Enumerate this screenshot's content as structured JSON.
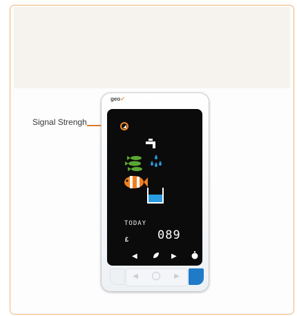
{
  "annotation": {
    "label": "Signal Strengh"
  },
  "device": {
    "brand": "geo",
    "brand_mark": "✓",
    "screen": {
      "day_label": "TODAY",
      "currency_symbol": "£",
      "reading": "089",
      "icons": [
        "signal-strength-icon",
        "water-tap-icon",
        "water-drops-icon",
        "fish-icon",
        "clownfish-icon",
        "water-tank-icon"
      ],
      "controls": [
        "left-arrow-icon",
        "leaf-icon",
        "right-arrow-icon",
        "timer-icon"
      ]
    },
    "buttons": [
      "left-button",
      "center-button",
      "right-button"
    ]
  },
  "colors": {
    "frame_border": "#f2b27a",
    "banner": "#f6f3ef",
    "leader": "#e07b25",
    "screen": "#0b0b0b",
    "fish": "#5aa832",
    "clownfish": "#f07f1f",
    "water": "#2a9be0",
    "accent_button": "#1f7ac7"
  }
}
